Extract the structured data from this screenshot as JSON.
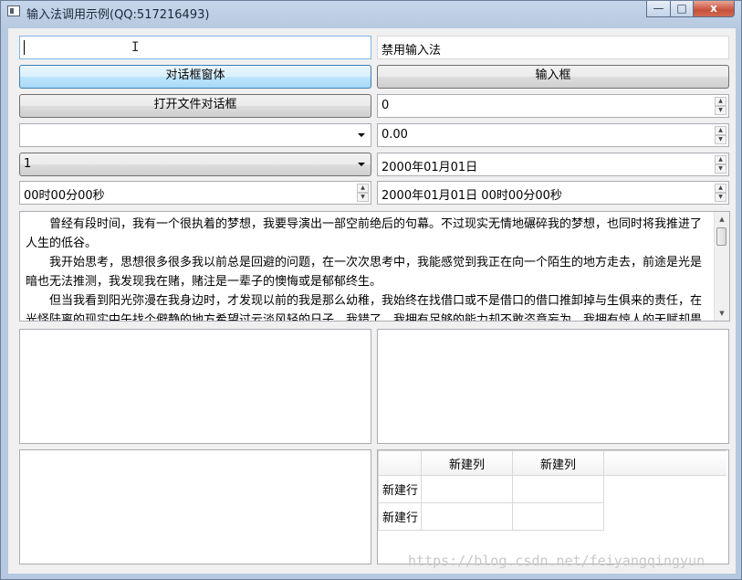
{
  "window": {
    "title": "输入法调用示例(QQ:517216493)",
    "minimize": "—",
    "maximize": "□",
    "close": "x"
  },
  "controls": {
    "lineedit_value": "",
    "lineedit_disabled_value": "禁用输入法",
    "dialog_button": "对话框窗体",
    "inputbox_button": "输入框",
    "file_dialog_button": "打开文件对话框",
    "spinbox_value": "0",
    "combo_empty_value": "",
    "double_spinbox_value": "0.00",
    "combo_value": "1",
    "date_value": "2000年01月01日",
    "time_value": "00时00分00秒",
    "datetime_value": "2000年01月01日 00时00分00秒"
  },
  "textedit": {
    "paragraphs": [
      "曾经有段时间，我有一个很执着的梦想，我要导演出一部空前绝后的句幕。不过现实无情地碾碎我的梦想，也同时将我推进了人生的低谷。",
      "我开始思考，思想很多很多我以前总是回避的问题，在一次次思考中，我能感觉到我正在向一个陌生的地方走去，前途是光是暗也无法推测，我发现我在赌，赌注是一辈子的懊悔或是郁郁终生。",
      "但当我看到阳光弥漫在我身边时，才发现以前的我是那么幼稚，我始终在找借口或不是借口的借口推卸掉与生俱来的责任，在光怪陆离的现实中午找个僻静的地方希望过云淡风轻的日子。我错了，我拥有足够的能力却不敢恣意妄为，我拥有惊人的天赋却畏惧前景未知，到了我该拼搏的时候了，只有做不到，没有不可以。"
    ]
  },
  "table": {
    "column_headers": [
      "新建列",
      "新建列"
    ],
    "row_headers": [
      "新建行",
      "新建行"
    ]
  },
  "watermark": "https://blog.csdn.net/feiyangqingyun",
  "icons": {
    "up": "▲",
    "down": "▼"
  }
}
